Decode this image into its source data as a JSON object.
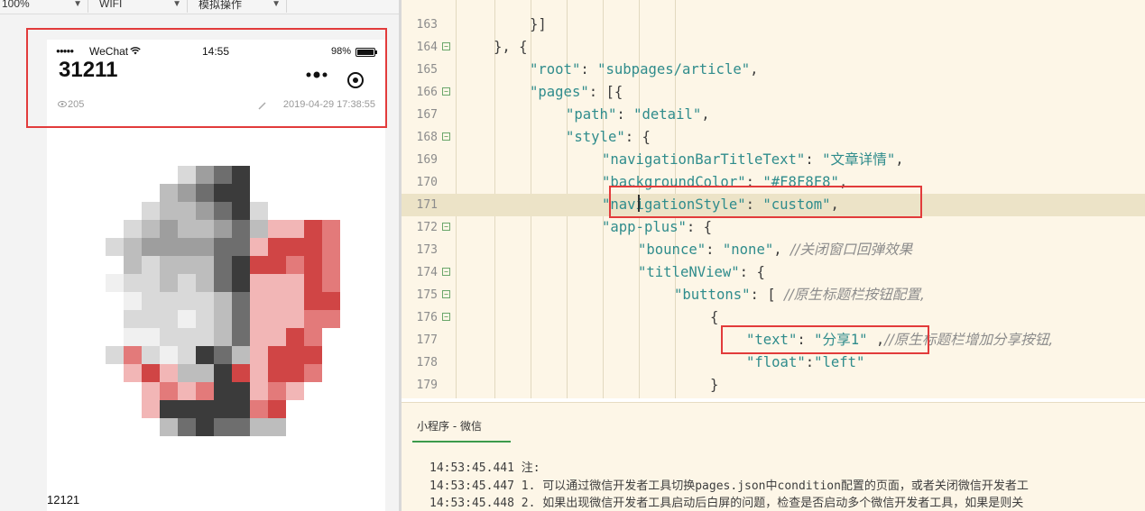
{
  "toolbar": {
    "zoom": "100%",
    "network": "WIFI",
    "simulate_action": "模拟操作"
  },
  "simulator": {
    "status_bar": {
      "signal": "●●●●●",
      "carrier": "WeChat",
      "time": "14:55",
      "battery": "98%"
    },
    "article": {
      "title": "31211",
      "views": "205",
      "date": "2019-04-29 17:38:55",
      "footer_text": "12121"
    }
  },
  "editor": {
    "lines": [
      {
        "n": "163",
        "fold": false
      },
      {
        "n": "164",
        "fold": true
      },
      {
        "n": "165",
        "fold": false
      },
      {
        "n": "166",
        "fold": true
      },
      {
        "n": "167",
        "fold": false
      },
      {
        "n": "168",
        "fold": true
      },
      {
        "n": "169",
        "fold": false
      },
      {
        "n": "170",
        "fold": false
      },
      {
        "n": "171",
        "fold": false
      },
      {
        "n": "172",
        "fold": true
      },
      {
        "n": "173",
        "fold": false
      },
      {
        "n": "174",
        "fold": true
      },
      {
        "n": "175",
        "fold": true
      },
      {
        "n": "176",
        "fold": true
      },
      {
        "n": "177",
        "fold": false
      },
      {
        "n": "178",
        "fold": false
      },
      {
        "n": "179",
        "fold": false
      }
    ],
    "code": {
      "l163": "}]",
      "l164": "}, {",
      "l165_key": "\"root\"",
      "l165_val": "\"subpages/article\"",
      "l166_key": "\"pages\"",
      "l166_rest": ": [{",
      "l167_key": "\"path\"",
      "l167_val": "\"detail\"",
      "l168_key": "\"style\"",
      "l168_rest": ": {",
      "l169_key": "\"navigationBarTitleText\"",
      "l169_val": "\"文章详情\"",
      "l170_key": "\"backgroundColor\"",
      "l170_val": "\"#F8F8F8\"",
      "l171_key": "\"navigationStyle\"",
      "l171_val": "\"custom\"",
      "l172_key": "\"app-plus\"",
      "l172_rest": ": {",
      "l173_key": "\"bounce\"",
      "l173_val": "\"none\"",
      "l173_comment": "//关闭窗口回弹效果",
      "l174_key": "\"titleNView\"",
      "l174_rest": ": {",
      "l175_key": "\"buttons\"",
      "l175_rest": ": [ ",
      "l175_comment": "//原生标题栏按钮配置,",
      "l176": "{",
      "l177_key": "\"text\"",
      "l177_val": "\"分享1\"",
      "l177_comment": "//原生标题栏增加分享按钮,",
      "l178_key": "\"float\"",
      "l178_val": "\"left\"",
      "l179": "}"
    }
  },
  "console": {
    "tab_label": "小程序 - 微信",
    "logs": [
      {
        "time": "14:53:45.441",
        "msg": "注:"
      },
      {
        "time": "14:53:45.447",
        "msg": "1. 可以通过微信开发者工具切换pages.json中condition配置的页面，或者关闭微信开发者工"
      },
      {
        "time": "14:53:45.448",
        "msg": "2. 如果出现微信开发者工具启动后白屏的问题，检查是否启动多个微信开发者工具，如果是则关"
      }
    ]
  }
}
